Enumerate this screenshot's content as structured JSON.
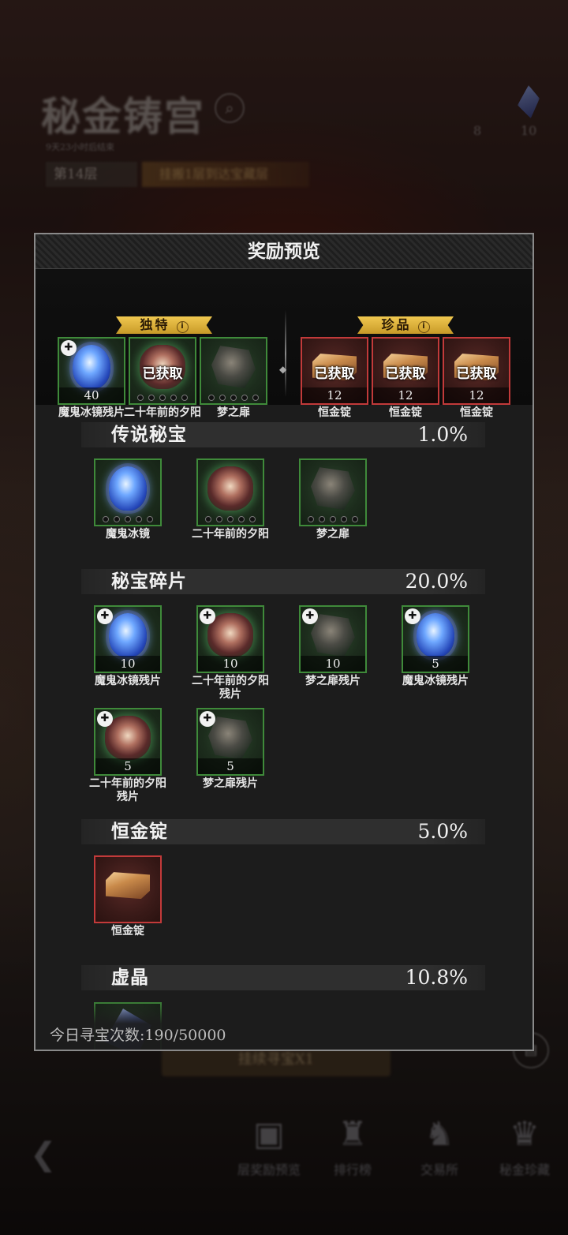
{
  "background": {
    "title": "秘金铸宫",
    "subtitle": "9天23小时后结束",
    "level": "第14层",
    "goal": "挂搬1层到达宝藏层",
    "currency_left": "8",
    "currency_right": "10",
    "bottom_button": "挂续寻宝X1",
    "nav": [
      {
        "label": "层奖励预览",
        "icon": "chest-icon"
      },
      {
        "label": "排行榜",
        "icon": "trophy-icon"
      },
      {
        "label": "交易所",
        "icon": "exchange-icon"
      },
      {
        "label": "秘金珍藏",
        "icon": "collection-icon"
      }
    ]
  },
  "modal": {
    "title": "奖励预览",
    "featured": {
      "unique_label": "独特",
      "rare_label": "珍品",
      "unique_items": [
        {
          "name": "魔鬼冰镜残片",
          "qty": "40",
          "art": "mirror",
          "fragment": true,
          "status": ""
        },
        {
          "name": "二十年前的夕阳",
          "qty": "",
          "art": "sunset",
          "fragment": false,
          "status": "已获取"
        },
        {
          "name": "梦之扉",
          "qty": "",
          "art": "door",
          "fragment": false,
          "status": ""
        }
      ],
      "rare_items": [
        {
          "name": "恒金锭",
          "qty": "12",
          "status": "已获取"
        },
        {
          "name": "恒金锭",
          "qty": "12",
          "status": "已获取"
        },
        {
          "name": "恒金锭",
          "qty": "12",
          "status": "已获取"
        }
      ]
    },
    "sections": [
      {
        "name": "传说秘宝",
        "percent": "1.0%",
        "items": [
          {
            "name": "魔鬼冰镜"
          },
          {
            "name": "二十年前的夕阳"
          },
          {
            "name": "梦之扉"
          }
        ]
      },
      {
        "name": "秘宝碎片",
        "percent": "20.0%",
        "items": [
          {
            "name": "魔鬼冰镜残片",
            "qty": "10"
          },
          {
            "name": "二十年前的夕阳残片",
            "qty": "10"
          },
          {
            "name": "梦之扉残片",
            "qty": "10"
          },
          {
            "name": "魔鬼冰镜残片",
            "qty": "5"
          },
          {
            "name": "二十年前的夕阳残片",
            "qty": "5"
          },
          {
            "name": "梦之扉残片",
            "qty": "5"
          }
        ]
      },
      {
        "name": "恒金锭",
        "percent": "5.0%",
        "items": [
          {
            "name": "恒金锭"
          }
        ]
      },
      {
        "name": "虚晶",
        "percent": "10.8%",
        "items": []
      }
    ],
    "footer_label": "今日寻宝次数:",
    "footer_value": "190/50000"
  },
  "colors": {
    "common_border": "#3f8a3a",
    "rare_border": "#c23a3a",
    "ribbon_gold": "#f0c850"
  }
}
